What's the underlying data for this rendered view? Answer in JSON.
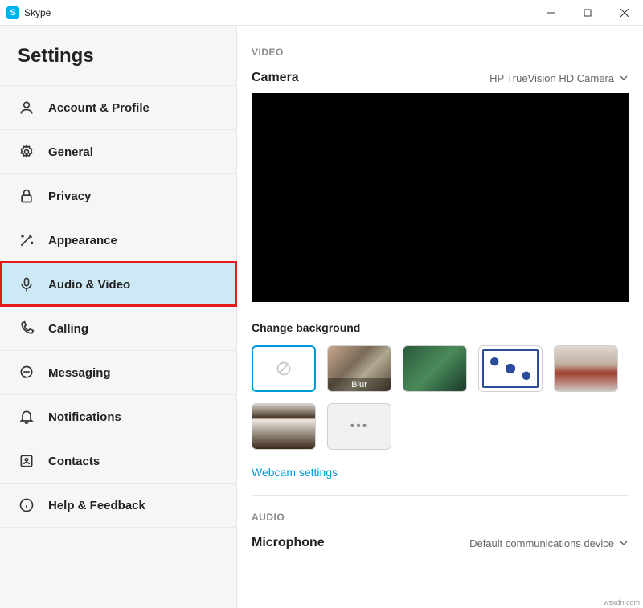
{
  "titlebar": {
    "app_name": "Skype",
    "icon_letter": "S"
  },
  "sidebar": {
    "title": "Settings",
    "items": [
      {
        "label": "Account & Profile",
        "icon": "person"
      },
      {
        "label": "General",
        "icon": "gear"
      },
      {
        "label": "Privacy",
        "icon": "lock"
      },
      {
        "label": "Appearance",
        "icon": "wand"
      },
      {
        "label": "Audio & Video",
        "icon": "mic",
        "active": true
      },
      {
        "label": "Calling",
        "icon": "phone"
      },
      {
        "label": "Messaging",
        "icon": "chat"
      },
      {
        "label": "Notifications",
        "icon": "bell"
      },
      {
        "label": "Contacts",
        "icon": "contacts"
      },
      {
        "label": "Help & Feedback",
        "icon": "info"
      }
    ]
  },
  "content": {
    "video_section": "VIDEO",
    "camera_label": "Camera",
    "camera_device": "HP TrueVision HD Camera",
    "change_bg_label": "Change background",
    "blur_label": "Blur",
    "webcam_link": "Webcam settings",
    "audio_section": "AUDIO",
    "mic_label": "Microphone",
    "mic_device": "Default communications device"
  },
  "watermark": "wsxdn.com"
}
